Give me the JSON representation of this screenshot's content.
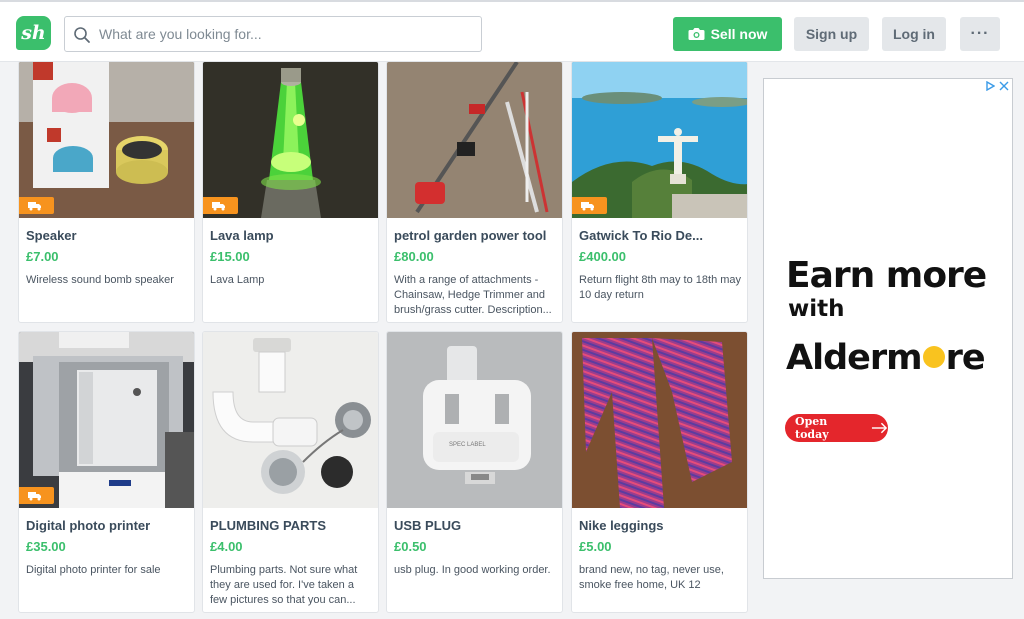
{
  "header": {
    "logo_text": "sh",
    "search_placeholder": "What are you looking for...",
    "sell_label": "Sell now",
    "signup_label": "Sign up",
    "login_label": "Log in",
    "more_label": "···"
  },
  "listings": [
    {
      "title": "Speaker",
      "price": "£7.00",
      "description": "Wireless sound bomb speaker",
      "delivery": true
    },
    {
      "title": "Lava lamp",
      "price": "£15.00",
      "description": "Lava Lamp",
      "delivery": true
    },
    {
      "title": "petrol garden power tool",
      "price": "£80.00",
      "description": "With a range of attachments - Chainsaw, Hedge Trimmer and brush/grass cutter. Description...",
      "delivery": false
    },
    {
      "title": "Gatwick To Rio De...",
      "price": "£400.00",
      "description": "Return flight 8th may to 18th may 10 day return",
      "delivery": true
    },
    {
      "title": "Digital photo printer",
      "price": "£35.00",
      "description": "Digital photo printer for sale",
      "delivery": true
    },
    {
      "title": "PLUMBING PARTS",
      "price": "£4.00",
      "description": "Plumbing parts. Not sure what they are used for. I've taken a few pictures so that you can...",
      "delivery": false
    },
    {
      "title": "USB PLUG",
      "price": "£0.50",
      "description": "usb plug. In good working order.",
      "delivery": false
    },
    {
      "title": "Nike leggings",
      "price": "£5.00",
      "description": "brand new, no tag, never use, smoke free home, UK 12",
      "delivery": false
    }
  ],
  "ad": {
    "line1": "Earn more",
    "line2": "with",
    "brand_start": "Alderm",
    "brand_end": "re",
    "cta": "Open today"
  },
  "colors": {
    "brand_green": "#3bbf6c",
    "delivery_orange": "#f7931e",
    "ad_red": "#e4262c",
    "ad_yellow": "#f9c31f"
  }
}
